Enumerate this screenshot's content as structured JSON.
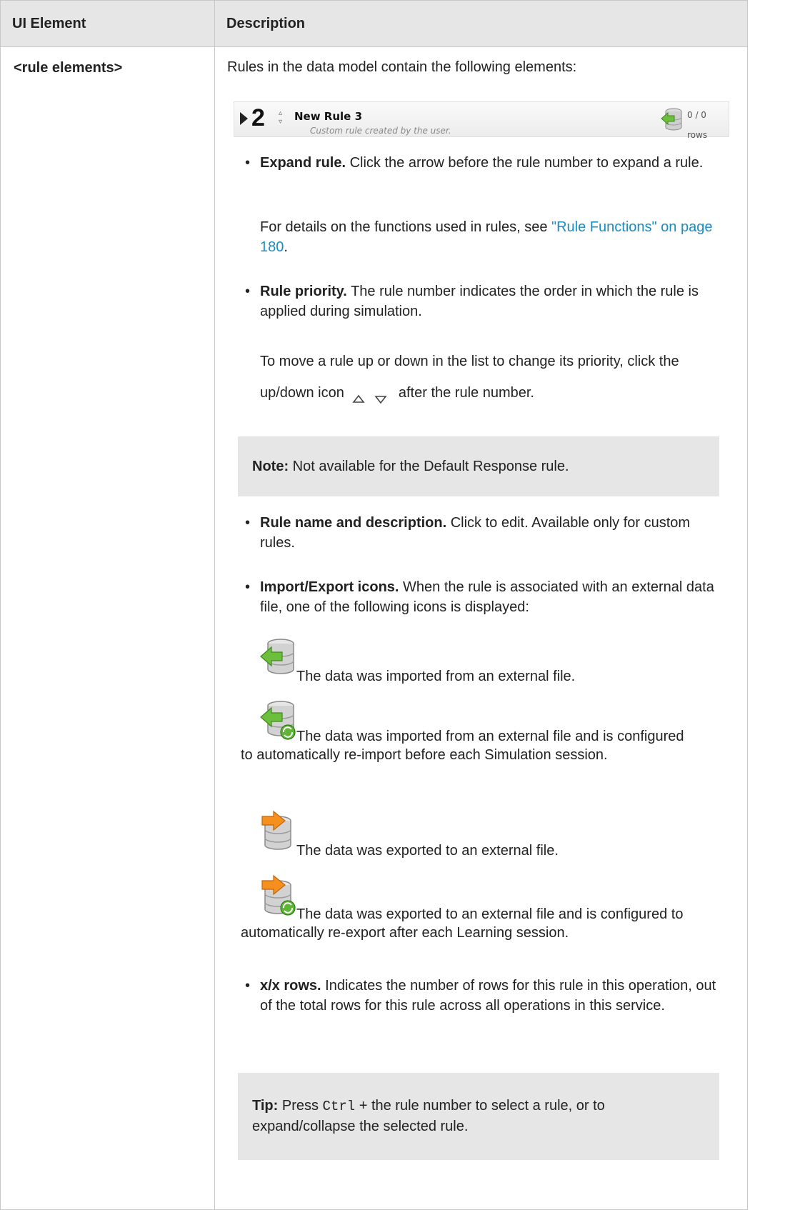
{
  "header": {
    "col1": "UI Element",
    "col2": "Description"
  },
  "row": {
    "element": "<rule elements>",
    "intro": "Rules in the data model contain the following elements:",
    "rule_preview": {
      "number": "2",
      "name": "New Rule 3",
      "description": "Custom rule created by the user.",
      "rows": "0 / 0 rows"
    },
    "expand": {
      "title": "Expand rule.",
      "text": " Click the arrow before the rule number to expand a rule.",
      "details_prefix": "For details on the functions used in rules, see ",
      "link": "\"Rule Functions\" on page 180",
      "details_suffix": "."
    },
    "priority": {
      "title": "Rule priority.",
      "text": " The rule number indicates the order in which the rule is applied during simulation.",
      "move_prefix": "To move a rule up or down in the list to change its priority, click the up/down icon",
      "move_suffix": "after the rule number."
    },
    "note": {
      "label": "Note:",
      "text": " Not available for the Default Response rule."
    },
    "name_desc": {
      "title": "Rule name and description.",
      "text": " Click to edit. Available only for custom rules."
    },
    "import_export": {
      "title": "Import/Export icons.",
      "text": " When the rule is associated with an external data file, one of the following icons is displayed:",
      "icons": [
        {
          "icon": "db-import-icon",
          "text": " The data was imported from an external file."
        },
        {
          "icon": "db-import-refresh-icon",
          "text": " The data was imported from an external file and is configured to automatically re-import before each Simulation session."
        },
        {
          "icon": "db-export-icon",
          "text": " The data was exported to an external file."
        },
        {
          "icon": "db-export-refresh-icon",
          "text": " The data was exported to an external file and is configured to automatically re-export after each Learning session."
        }
      ]
    },
    "rows": {
      "title": "x/x rows.",
      "text": " Indicates the number of rows for this rule in this operation, out of the total rows for this rule across all operations in this service."
    },
    "tip": {
      "label": "Tip:",
      "text_before": " Press ",
      "key": "Ctrl",
      "text_after": " + the rule number to select a rule, or to expand/collapse the selected rule."
    }
  },
  "colors": {
    "link": "#1a8cc4",
    "header_bg": "#e6e6e6",
    "box_bg": "#e6e6e6",
    "import_arrow": "#6cbf3c",
    "export_arrow": "#f5901e"
  }
}
